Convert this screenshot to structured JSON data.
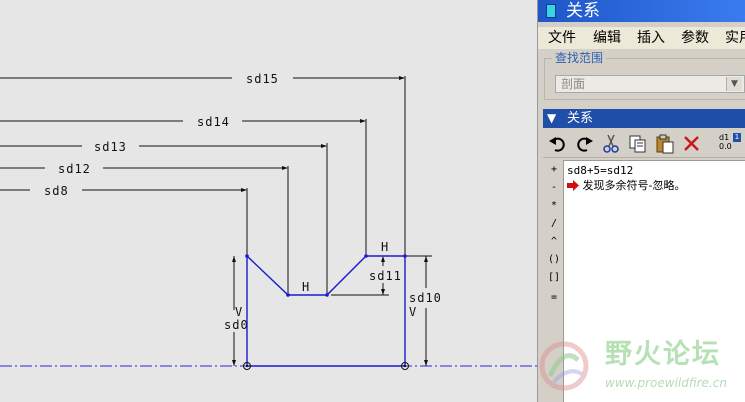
{
  "sketch": {
    "dimensions": {
      "sd15": "sd15",
      "sd14": "sd14",
      "sd13": "sd13",
      "sd12": "sd12",
      "sd8": "sd8",
      "sd11": "sd11",
      "sd10": "sd10",
      "sd0": "sd0"
    },
    "constraints": {
      "h_top_right": "H",
      "h_bottom": "H",
      "v_left": "V",
      "v_right": "V"
    },
    "colors": {
      "geometry": "#1a1ad0",
      "centerline": "#2a2ae0",
      "dimension": "#111111"
    }
  },
  "panel": {
    "title": "关系",
    "menu": [
      "文件",
      "编辑",
      "插入",
      "参数",
      "实用"
    ],
    "filter": {
      "label": "查找范围",
      "value": "剖面"
    },
    "section_title": "关系",
    "toolbar": {
      "undo_icon": "undo-icon",
      "redo_icon": "redo-icon",
      "cut_icon": "cut-icon",
      "copy_icon": "copy-icon",
      "paste_icon": "paste-icon",
      "delete_icon": "delete-icon",
      "dims_icon_top": "d1",
      "dims_icon_bottom": "0.0"
    },
    "operators": [
      "+",
      "-",
      "*",
      "/",
      "^",
      "()",
      "[]",
      "="
    ],
    "editor": {
      "line1": "sd8+5=sd12",
      "line2": "发现多余符号-忽略。"
    }
  },
  "watermark": {
    "title": "野火论坛",
    "url": "www.proewildfire.cn"
  }
}
